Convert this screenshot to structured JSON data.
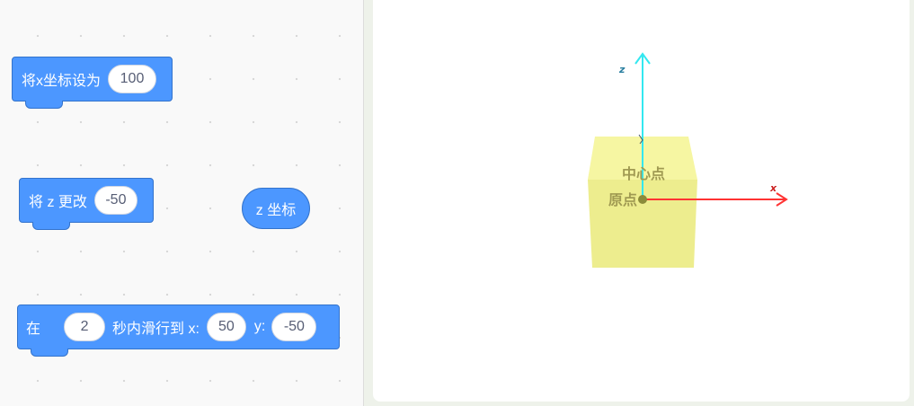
{
  "code_area": {
    "block_set_x": {
      "label": "将x坐标设为",
      "value": "100"
    },
    "block_change_z": {
      "label": "将 z 更改",
      "value": "-50"
    },
    "reporter_z": {
      "label": "z 坐标"
    },
    "block_glide": {
      "prefix": "在",
      "seconds": "2",
      "middle": "秒内滑行到 x:",
      "x_value": "50",
      "y_label": "y:",
      "y_value": "-50"
    }
  },
  "stage": {
    "axis_z_label": "z",
    "axis_x_label": "x",
    "center_point_label": "中心点",
    "origin_label": "原点"
  },
  "colors": {
    "block_blue": "#4c97ff",
    "block_border": "#3373cc",
    "axis_z": "#33e8f0",
    "axis_x": "#ff3333",
    "cube": "#f3f38a"
  }
}
